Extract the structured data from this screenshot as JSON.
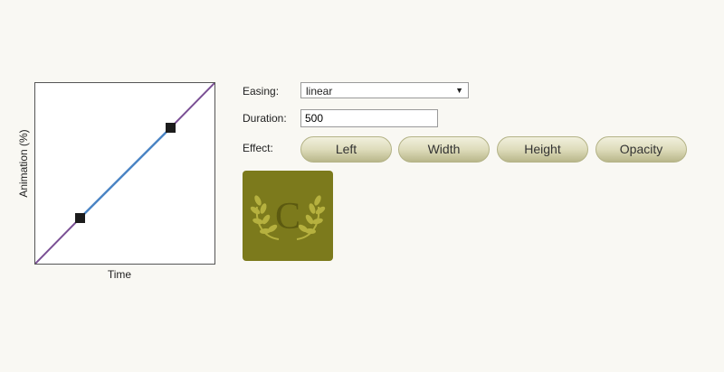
{
  "graph": {
    "ylabel": "Animation (%)",
    "xlabel": "Time",
    "colors": {
      "curve_outer": "#7a4f94",
      "curve_inner": "#4a84c4",
      "handle": "#1c1c1c"
    }
  },
  "controls": {
    "easing_label": "Easing:",
    "easing_value": "linear",
    "duration_label": "Duration:",
    "duration_value": "500",
    "effect_label": "Effect:",
    "effects": [
      "Left",
      "Width",
      "Height",
      "Opacity"
    ]
  },
  "preview": {
    "letter": "C",
    "colors": {
      "box": "#7c7a1c",
      "emblem": "#b6b13f",
      "letter": "#5c5a10"
    }
  }
}
